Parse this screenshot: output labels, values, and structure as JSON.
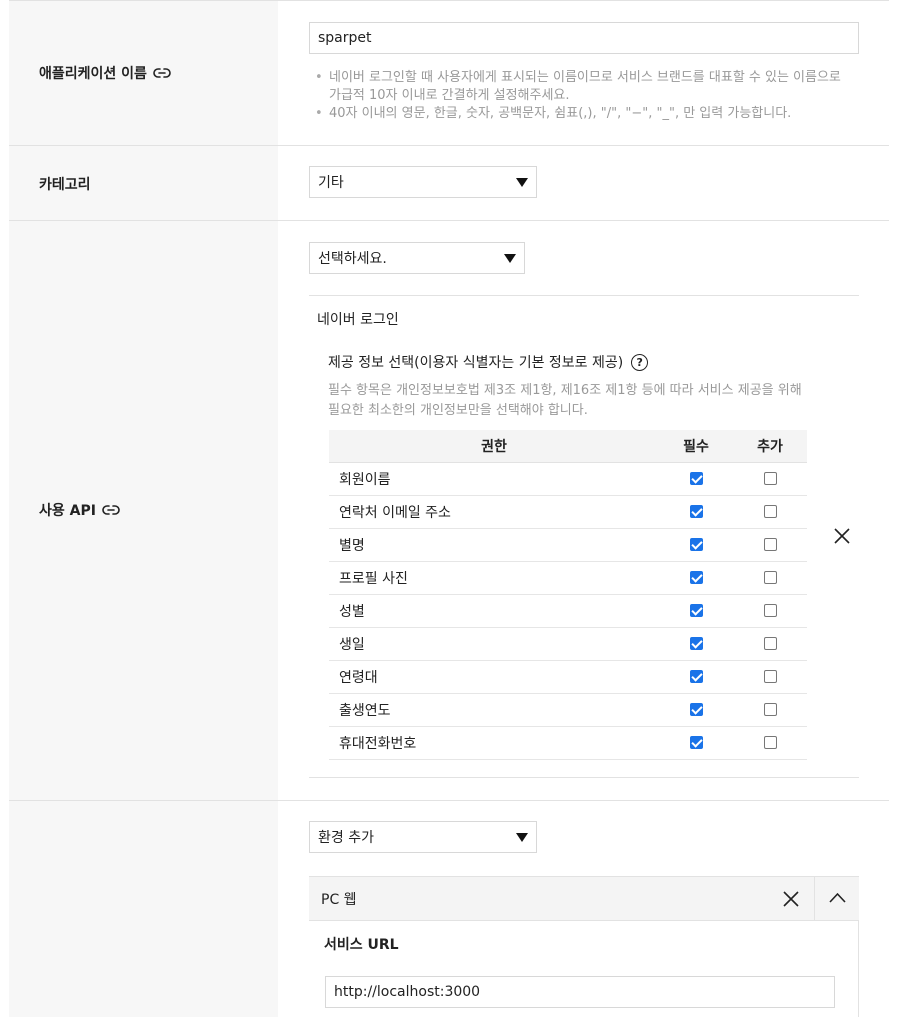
{
  "app_name": {
    "label": "애플리케이션 이름",
    "value": "sparpet",
    "hints": [
      "네이버 로그인할 때 사용자에게 표시되는 이름이므로 서비스 브랜드를 대표할 수 있는 이름으로 가급적 10자 이내로 간결하게 설정해주세요.",
      "40자 이내의 영문, 한글, 숫자, 공백문자, 쉼표(,), \"/\", \"−\", \"_\", 만 입력 가능합니다."
    ]
  },
  "category": {
    "label": "카테고리",
    "selected": "기타"
  },
  "api": {
    "label": "사용 API",
    "select_placeholder": "선택하세요.",
    "section_title": "네이버 로그인",
    "info_title": "제공 정보 선택(이용자 식별자는 기본 정보로 제공)",
    "info_desc": "필수 항목은 개인정보보호법 제3조 제1항, 제16조 제1항 등에 따라 서비스 제공을 위해 필요한 최소한의 개인정보만을 선택해야 합니다.",
    "columns": [
      "권한",
      "필수",
      "추가"
    ],
    "rows": [
      {
        "name": "회원이름",
        "required": true,
        "additional": false
      },
      {
        "name": "연락처 이메일 주소",
        "required": true,
        "additional": false
      },
      {
        "name": "별명",
        "required": true,
        "additional": false
      },
      {
        "name": "프로필 사진",
        "required": true,
        "additional": false
      },
      {
        "name": "성별",
        "required": true,
        "additional": false
      },
      {
        "name": "생일",
        "required": true,
        "additional": false
      },
      {
        "name": "연령대",
        "required": true,
        "additional": false
      },
      {
        "name": "출생연도",
        "required": true,
        "additional": false
      },
      {
        "name": "휴대전화번호",
        "required": true,
        "additional": false
      }
    ]
  },
  "env": {
    "select_label": "환경 추가",
    "panel_title": "PC 웹",
    "service_url_label": "서비스 URL",
    "service_url_value": "http://localhost:3000"
  },
  "icons": {
    "link": "link-icon",
    "help": "question-circle-icon",
    "close": "close-icon",
    "collapse": "chevron-up-icon",
    "dropdown": "caret-down-icon"
  },
  "colors": {
    "checkbox_checked": "#1a73e8",
    "label_bg": "#f7f7f7",
    "hint_text": "#999999"
  }
}
